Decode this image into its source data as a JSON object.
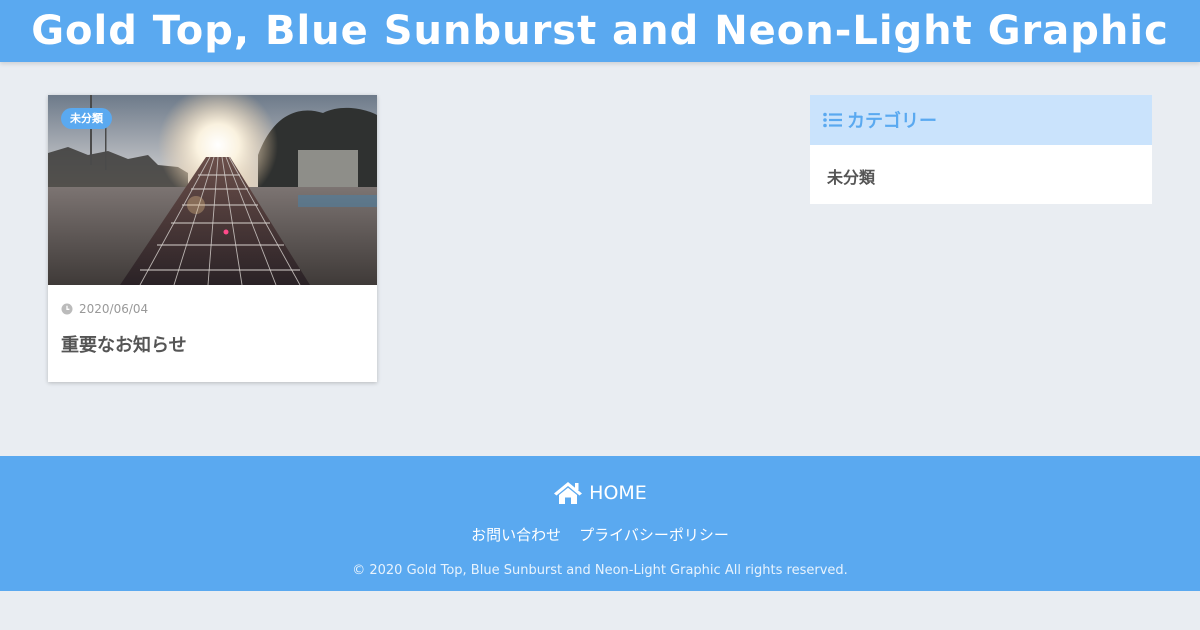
{
  "header": {
    "site_title": "Gold Top, Blue Sunburst and Neon-Light Graphic"
  },
  "posts": [
    {
      "category": "未分類",
      "date": "2020/06/04",
      "title": "重要なお知らせ",
      "thumbnail": "guitar-neck-sunset-photo"
    }
  ],
  "sidebar": {
    "widget_title": "カテゴリー",
    "widget_icon": "list-icon",
    "categories": [
      "未分類"
    ]
  },
  "footer": {
    "home_label": "HOME",
    "home_icon": "home-icon",
    "links": [
      "お問い合わせ",
      "プライバシーポリシー"
    ],
    "copyright": "© 2020 Gold Top, Blue Sunburst and Neon-Light Graphic All rights reserved."
  },
  "colors": {
    "accent": "#5aa9f0",
    "accent_light": "#cae3fc",
    "background": "#e9edf2"
  }
}
